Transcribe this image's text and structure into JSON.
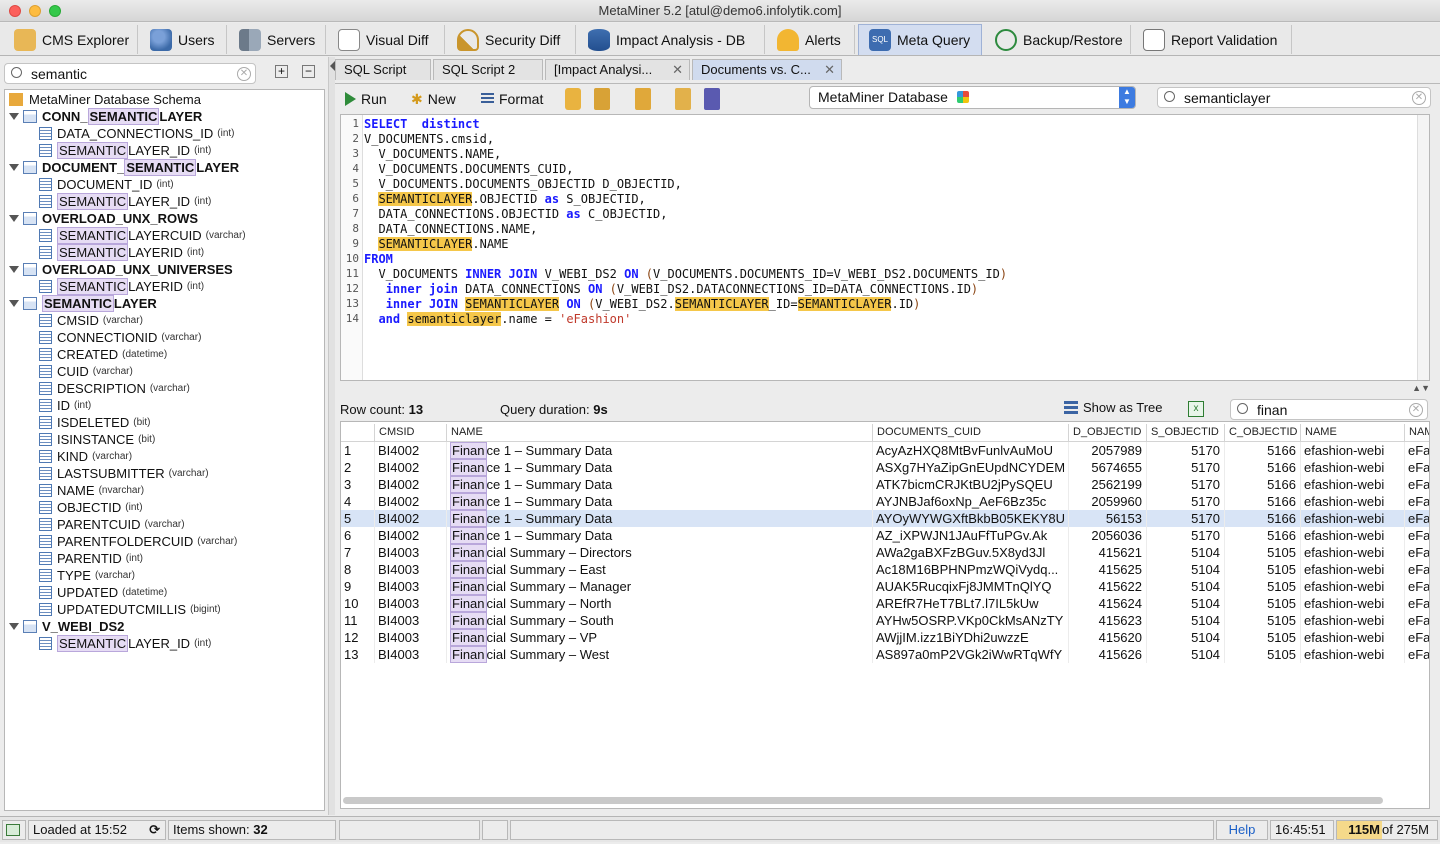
{
  "window": {
    "title": "MetaMiner 5.2 [atul@demo6.infolytik.com]"
  },
  "main_tabs": [
    {
      "label": "CMS Explorer",
      "icon": "cms-explorer-icon"
    },
    {
      "label": "Users",
      "icon": "users-icon"
    },
    {
      "label": "Servers",
      "icon": "servers-icon"
    },
    {
      "label": "Visual Diff",
      "icon": "visual-diff-icon"
    },
    {
      "label": "Security Diff",
      "icon": "key-icon"
    },
    {
      "label": "Impact Analysis - DB",
      "icon": "database-icon"
    },
    {
      "label": "Alerts",
      "icon": "bell-icon"
    },
    {
      "label": "Meta Query",
      "icon": "sql-icon"
    },
    {
      "label": "Backup/Restore",
      "icon": "history-icon"
    },
    {
      "label": "Report Validation",
      "icon": "report-icon"
    }
  ],
  "left": {
    "search_value": "semantic",
    "root_label": "MetaMiner Database Schema",
    "tree": [
      {
        "kind": "table",
        "pre": "CONN_",
        "hl": "SEMANTIC",
        "post": "LAYER",
        "type": ""
      },
      {
        "kind": "col",
        "pre": "DATA_CONNECTIONS_ID",
        "hl": "",
        "post": "",
        "type": "(int)"
      },
      {
        "kind": "col",
        "pre": "",
        "hl": "SEMANTIC",
        "post": "LAYER_ID",
        "type": "(int)"
      },
      {
        "kind": "table",
        "pre": "DOCUMENT_",
        "hl": "SEMANTIC",
        "post": "LAYER",
        "type": ""
      },
      {
        "kind": "col",
        "pre": "DOCUMENT_ID",
        "hl": "",
        "post": "",
        "type": "(int)"
      },
      {
        "kind": "col",
        "pre": "",
        "hl": "SEMANTIC",
        "post": "LAYER_ID",
        "type": "(int)"
      },
      {
        "kind": "table",
        "pre": "OVERLOAD_UNX_ROWS",
        "hl": "",
        "post": "",
        "type": ""
      },
      {
        "kind": "col",
        "pre": "",
        "hl": "SEMANTIC",
        "post": "LAYERCUID",
        "type": "(varchar)"
      },
      {
        "kind": "col",
        "pre": "",
        "hl": "SEMANTIC",
        "post": "LAYERID",
        "type": "(int)"
      },
      {
        "kind": "table",
        "pre": "OVERLOAD_UNX_UNIVERSES",
        "hl": "",
        "post": "",
        "type": ""
      },
      {
        "kind": "col",
        "pre": "",
        "hl": "SEMANTIC",
        "post": "LAYERID",
        "type": "(int)"
      },
      {
        "kind": "table",
        "pre": "",
        "hl": "SEMANTIC",
        "post": "LAYER",
        "type": ""
      },
      {
        "kind": "col",
        "pre": "CMSID",
        "hl": "",
        "post": "",
        "type": "(varchar)"
      },
      {
        "kind": "col",
        "pre": "CONNECTIONID",
        "hl": "",
        "post": "",
        "type": "(varchar)"
      },
      {
        "kind": "col",
        "pre": "CREATED",
        "hl": "",
        "post": "",
        "type": "(datetime)"
      },
      {
        "kind": "col",
        "pre": "CUID",
        "hl": "",
        "post": "",
        "type": "(varchar)"
      },
      {
        "kind": "col",
        "pre": "DESCRIPTION",
        "hl": "",
        "post": "",
        "type": "(varchar)"
      },
      {
        "kind": "col",
        "pre": "ID",
        "hl": "",
        "post": "",
        "type": "(int)"
      },
      {
        "kind": "col",
        "pre": "ISDELETED",
        "hl": "",
        "post": "",
        "type": "(bit)"
      },
      {
        "kind": "col",
        "pre": "ISINSTANCE",
        "hl": "",
        "post": "",
        "type": "(bit)"
      },
      {
        "kind": "col",
        "pre": "KIND",
        "hl": "",
        "post": "",
        "type": "(varchar)"
      },
      {
        "kind": "col",
        "pre": "LASTSUBMITTER",
        "hl": "",
        "post": "",
        "type": "(varchar)"
      },
      {
        "kind": "col",
        "pre": "NAME",
        "hl": "",
        "post": "",
        "type": "(nvarchar)"
      },
      {
        "kind": "col",
        "pre": "OBJECTID",
        "hl": "",
        "post": "",
        "type": "(int)"
      },
      {
        "kind": "col",
        "pre": "PARENTCUID",
        "hl": "",
        "post": "",
        "type": "(varchar)"
      },
      {
        "kind": "col",
        "pre": "PARENTFOLDERCUID",
        "hl": "",
        "post": "",
        "type": "(varchar)"
      },
      {
        "kind": "col",
        "pre": "PARENTID",
        "hl": "",
        "post": "",
        "type": "(int)"
      },
      {
        "kind": "col",
        "pre": "TYPE",
        "hl": "",
        "post": "",
        "type": "(varchar)"
      },
      {
        "kind": "col",
        "pre": "UPDATED",
        "hl": "",
        "post": "",
        "type": "(datetime)"
      },
      {
        "kind": "col",
        "pre": "UPDATEDUTCMILLIS",
        "hl": "",
        "post": "",
        "type": "(bigint)"
      },
      {
        "kind": "table",
        "pre": "V_WEBI_DS2",
        "hl": "",
        "post": "",
        "type": ""
      },
      {
        "kind": "col",
        "pre": "",
        "hl": "SEMANTIC",
        "post": "LAYER_ID",
        "type": "(int)"
      }
    ]
  },
  "editor_tabs": [
    {
      "label": "SQL Script"
    },
    {
      "label": "SQL Script 2"
    },
    {
      "label": "[Impact Analysi..."
    },
    {
      "label": "Documents vs. C..."
    }
  ],
  "toolbar": {
    "run_label": "Run",
    "new_label": "New",
    "format_label": "Format",
    "db_select": "MetaMiner Database",
    "search_value": "semanticlayer"
  },
  "sql_lines": [
    [
      {
        "t": "SELECT  distinct",
        "c": "kw"
      }
    ],
    [
      {
        "t": "V_DOCUMENTS.cmsid,",
        "c": ""
      }
    ],
    [
      {
        "t": "  V_DOCUMENTS.NAME,",
        "c": ""
      }
    ],
    [
      {
        "t": "  V_DOCUMENTS.DOCUMENTS_CUID,",
        "c": ""
      }
    ],
    [
      {
        "t": "  V_DOCUMENTS.DOCUMENTS_OBJECTID D_OBJECTID,",
        "c": ""
      }
    ],
    [
      {
        "t": "  ",
        "c": ""
      },
      {
        "t": "SEMANTICLAYER",
        "c": "sem"
      },
      {
        "t": ".OBJECTID ",
        "c": ""
      },
      {
        "t": "as",
        "c": "kw"
      },
      {
        "t": " S_OBJECTID,",
        "c": ""
      }
    ],
    [
      {
        "t": "  DATA_CONNECTIONS.OBJECTID ",
        "c": ""
      },
      {
        "t": "as",
        "c": "kw"
      },
      {
        "t": " C_OBJECTID,",
        "c": ""
      }
    ],
    [
      {
        "t": "  DATA_CONNECTIONS.NAME,",
        "c": ""
      }
    ],
    [
      {
        "t": "  ",
        "c": ""
      },
      {
        "t": "SEMANTICLAYER",
        "c": "sem"
      },
      {
        "t": ".NAME",
        "c": ""
      }
    ],
    [
      {
        "t": "FROM",
        "c": "kw"
      }
    ],
    [
      {
        "t": "  V_DOCUMENTS ",
        "c": ""
      },
      {
        "t": "INNER JOIN",
        "c": "kw"
      },
      {
        "t": " V_WEBI_DS2 ",
        "c": ""
      },
      {
        "t": "ON",
        "c": "kw"
      },
      {
        "t": " ",
        "c": ""
      },
      {
        "t": "(",
        "c": "par"
      },
      {
        "t": "V_DOCUMENTS.DOCUMENTS_ID=V_WEBI_DS2.DOCUMENTS_ID",
        "c": ""
      },
      {
        "t": ")",
        "c": "par"
      }
    ],
    [
      {
        "t": "   ",
        "c": ""
      },
      {
        "t": "inner join",
        "c": "kw"
      },
      {
        "t": " DATA_CONNECTIONS ",
        "c": ""
      },
      {
        "t": "ON",
        "c": "kw"
      },
      {
        "t": " ",
        "c": ""
      },
      {
        "t": "(",
        "c": "par"
      },
      {
        "t": "V_WEBI_DS2.DATACONNECTIONS_ID=DATA_CONNECTIONS.ID",
        "c": ""
      },
      {
        "t": ")",
        "c": "par"
      }
    ],
    [
      {
        "t": "   ",
        "c": ""
      },
      {
        "t": "inner JOIN",
        "c": "kw"
      },
      {
        "t": " ",
        "c": ""
      },
      {
        "t": "SEMANTICLAYER",
        "c": "sem"
      },
      {
        "t": " ",
        "c": ""
      },
      {
        "t": "ON",
        "c": "kw"
      },
      {
        "t": " ",
        "c": ""
      },
      {
        "t": "(",
        "c": "par"
      },
      {
        "t": "V_WEBI_DS2.",
        "c": ""
      },
      {
        "t": "SEMANTICLAYER",
        "c": "sem"
      },
      {
        "t": "_ID=",
        "c": ""
      },
      {
        "t": "SEMANTICLAYER",
        "c": "sem"
      },
      {
        "t": ".ID",
        "c": ""
      },
      {
        "t": ")",
        "c": "par"
      }
    ],
    [
      {
        "t": "  ",
        "c": ""
      },
      {
        "t": "and",
        "c": "kw"
      },
      {
        "t": " ",
        "c": ""
      },
      {
        "t": "semanticlayer",
        "c": "sem"
      },
      {
        "t": ".name = ",
        "c": ""
      },
      {
        "t": "'eFashion'",
        "c": "str"
      }
    ]
  ],
  "results": {
    "row_count_label": "Row count:",
    "row_count": "13",
    "duration_label": "Query duration:",
    "duration": "9s",
    "show_tree_label": "Show as Tree",
    "filter_value": "finan",
    "columns": [
      "CMSID",
      "NAME",
      "DOCUMENTS_CUID",
      "D_OBJECTID",
      "S_OBJECTID",
      "C_OBJECTID",
      "NAME",
      "NAM"
    ],
    "rows": [
      [
        "1",
        "BI4002",
        "Finan",
        "ce 1 – Summary Data",
        "AcyAzHXQ8MtBvFunlvAuMoU",
        "2057989",
        "5170",
        "5166",
        "efashion-webi",
        "eFa"
      ],
      [
        "2",
        "BI4002",
        "Finan",
        "ce 1 – Summary Data",
        "ASXg7HYaZipGnEUpdNCYDEM",
        "5674655",
        "5170",
        "5166",
        "efashion-webi",
        "eFa"
      ],
      [
        "3",
        "BI4002",
        "Finan",
        "ce 1 – Summary Data",
        "ATK7bicmCRJKtBU2jPySQEU",
        "2562199",
        "5170",
        "5166",
        "efashion-webi",
        "eFa"
      ],
      [
        "4",
        "BI4002",
        "Finan",
        "ce 1 – Summary Data",
        "AYJNBJaf6oxNp_AeF6Bz35c",
        "2059960",
        "5170",
        "5166",
        "efashion-webi",
        "eFa"
      ],
      [
        "5",
        "BI4002",
        "Finan",
        "ce 1 – Summary Data",
        "AYOyWYWGXftBkbB05KEKY8U",
        "56153",
        "5170",
        "5166",
        "efashion-webi",
        "eFa"
      ],
      [
        "6",
        "BI4002",
        "Finan",
        "ce 1 – Summary Data",
        "AZ_iXPWJN1JAuFfTuPGv.Ak",
        "2056036",
        "5170",
        "5166",
        "efashion-webi",
        "eFa"
      ],
      [
        "7",
        "BI4003",
        "Finan",
        "cial Summary – Directors",
        "AWa2gaBXFzBGuv.5X8yd3Jl",
        "415621",
        "5104",
        "5105",
        "efashion-webi",
        "eFa"
      ],
      [
        "8",
        "BI4003",
        "Finan",
        "cial Summary – East",
        "Ac18M16BPHNPmzWQiVydq...",
        "415625",
        "5104",
        "5105",
        "efashion-webi",
        "eFa"
      ],
      [
        "9",
        "BI4003",
        "Finan",
        "cial Summary – Manager",
        "AUAK5RucqixFj8JMMTnQlYQ",
        "415622",
        "5104",
        "5105",
        "efashion-webi",
        "eFa"
      ],
      [
        "10",
        "BI4003",
        "Finan",
        "cial Summary – North",
        "AREfR7HeT7BLt7.l7IL5kUw",
        "415624",
        "5104",
        "5105",
        "efashion-webi",
        "eFa"
      ],
      [
        "11",
        "BI4003",
        "Finan",
        "cial Summary – South",
        "AYHw5OSRP.VKp0CkMsANzTY",
        "415623",
        "5104",
        "5105",
        "efashion-webi",
        "eFa"
      ],
      [
        "12",
        "BI4003",
        "Finan",
        "cial Summary – VP",
        "AWjjIM.izz1BiYDhi2uwzzE",
        "415620",
        "5104",
        "5105",
        "efashion-webi",
        "eFa"
      ],
      [
        "13",
        "BI4003",
        "Finan",
        "cial Summary – West",
        "AS897a0mP2VGk2iWwRTqWfY",
        "415626",
        "5104",
        "5105",
        "efashion-webi",
        "eFa"
      ]
    ],
    "selected_row": 5
  },
  "status": {
    "loaded": "Loaded at 15:52",
    "items_label": "Items shown:",
    "items_count": "32",
    "help": "Help",
    "time": "16:45:51",
    "mem_used": "115M",
    "mem_total": "of 275M"
  },
  "colors": {
    "highlight": "#f5c74a",
    "accent": "#d3ddf0",
    "selection": "#d8e4f6"
  }
}
